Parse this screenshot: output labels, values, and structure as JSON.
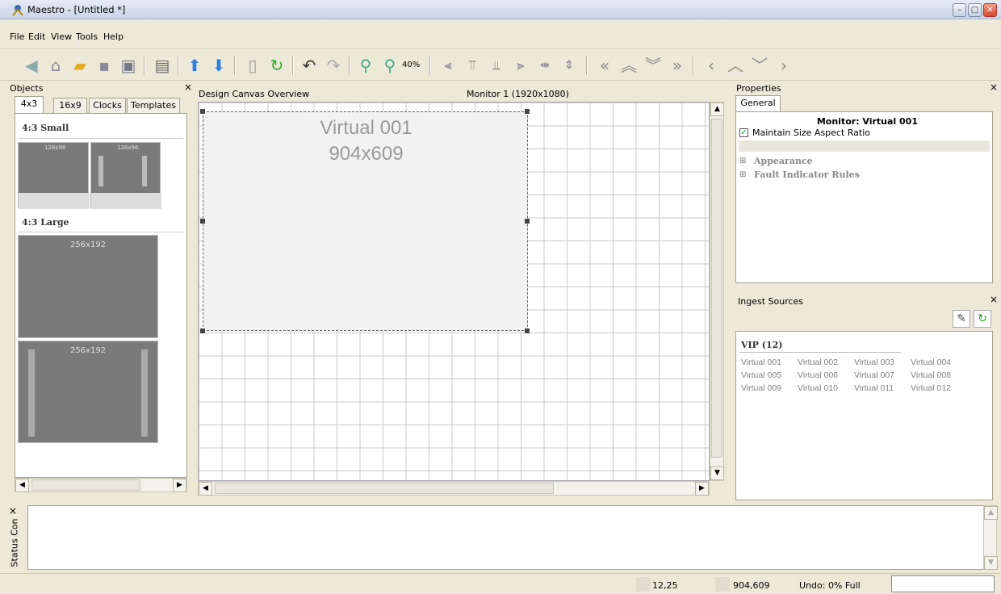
{
  "window": {
    "title": "Maestro - [Untitled *]"
  },
  "menu": [
    "File",
    "Edit",
    "View",
    "Tools",
    "Help"
  ],
  "toolbar": {
    "zoom_label": "40%",
    "icons": [
      "back-icon",
      "home-icon",
      "open-folder-icon",
      "save-icon",
      "save-as-icon",
      "clipboard-icon",
      "move-up-icon",
      "move-down-icon",
      "new-page-icon",
      "refresh-icon",
      "undo-icon",
      "redo-icon",
      "zoom-in-icon",
      "zoom-out-icon",
      "align-left-icon",
      "align-top-icon",
      "align-bottom-icon",
      "align-right-icon",
      "center-horizontal-icon",
      "center-vertical-icon",
      "send-to-back-icon",
      "send-backward-icon",
      "bring-forward-icon",
      "bring-to-front-icon",
      "nudge-left-icon",
      "nudge-up-icon",
      "nudge-down-icon",
      "nudge-right-icon"
    ]
  },
  "objects": {
    "title": "Objects",
    "close": "×",
    "tabs": [
      "4x3",
      "16x9",
      "Clocks",
      "Templates"
    ],
    "small_section": "4:3 Small",
    "small_thumbs": [
      "128x96",
      "128x96"
    ],
    "large_section": "4:3 Large",
    "large_thumbs": [
      "256x192",
      "256x192"
    ]
  },
  "canvas": {
    "title": "Design Canvas Overview",
    "monitor": "Monitor 1 (1920x1080)",
    "selected_name": "Virtual 001",
    "selected_size": "904x609"
  },
  "properties": {
    "title": "Properties",
    "close": "×",
    "tab": "General",
    "header": "Monitor: Virtual 001",
    "checkbox_label": "Maintain Size Aspect Ratio",
    "checkbox_checked": true,
    "groups": [
      "Appearance",
      "Fault Indicator Rules"
    ]
  },
  "ingest": {
    "title": "Ingest Sources",
    "close": "×",
    "group": "VIP (12)",
    "items": [
      "Virtual 001",
      "Virtual 002",
      "Virtual 003",
      "Virtual 004",
      "Virtual 005",
      "Virtual 006",
      "Virtual 007",
      "Virtual 008",
      "Virtual 009",
      "Virtual 010",
      "Virtual 011",
      "Virtual 012"
    ]
  },
  "status_console": {
    "title": "Status Con",
    "close": "×"
  },
  "statusbar": {
    "position": "12,25",
    "size": "904,609",
    "undo": "Undo: 0% Full"
  }
}
